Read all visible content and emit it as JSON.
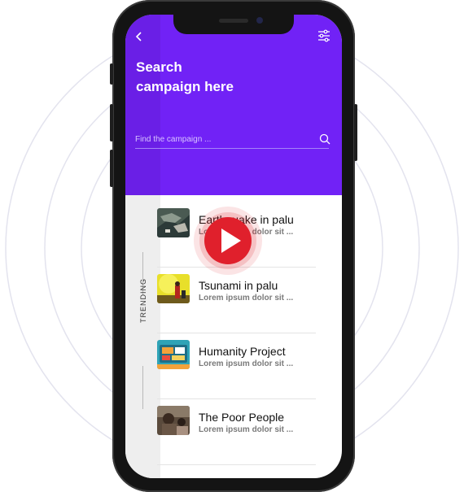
{
  "header": {
    "title_line1": "Search",
    "title_line2": "campaign here"
  },
  "search": {
    "placeholder": "Find the campaign ..."
  },
  "sidebar": {
    "label": "TRENDING"
  },
  "campaigns": [
    {
      "title": "Earthquake in palu",
      "subtitle": "Lorem ipsum dolor sit ...",
      "thumb": "aerial-earthquake"
    },
    {
      "title": "Tsunami in palu",
      "subtitle": "Lorem ipsum dolor sit ...",
      "thumb": "yellow-smoke"
    },
    {
      "title": "Humanity Project",
      "subtitle": "Lorem ipsum dolor sit ...",
      "thumb": "illustration"
    },
    {
      "title": "The Poor People",
      "subtitle": "Lorem ipsum dolor sit ...",
      "thumb": "people-photo"
    }
  ],
  "colors": {
    "header": "#7122f6",
    "play_button": "#e0202c"
  },
  "icons": [
    "back-arrow-icon",
    "filter-sliders-icon",
    "search-icon",
    "play-icon"
  ]
}
